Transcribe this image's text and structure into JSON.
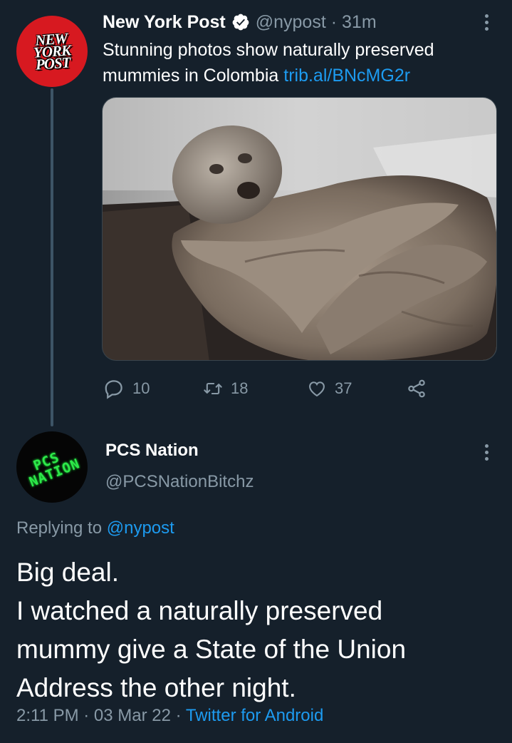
{
  "original_tweet": {
    "author": {
      "name": "New York Post",
      "handle": "@nypost",
      "time": "· 31m",
      "avatar_logo_lines": [
        "NEW",
        "YORK",
        "POST"
      ]
    },
    "text": "Stunning photos show naturally preserved mummies in Colombia ",
    "link": "trib.al/BNcMG2r",
    "media": {
      "icon": "photo-mummy"
    },
    "actions": {
      "replies": "10",
      "retweets": "18",
      "likes": "37"
    }
  },
  "reply_tweet": {
    "author": {
      "name": "PCS Nation",
      "handle": "@PCSNationBitchz",
      "avatar_logo_lines": [
        "PCS",
        "NATION"
      ]
    },
    "replying_to_label": "Replying to ",
    "replying_to_handle": "@nypost",
    "text_lines": [
      "Big deal.",
      "I watched a naturally preserved",
      "mummy give a State of the Union",
      "Address the other night."
    ],
    "timestamp": "2:11 PM · 03 Mar 22 · ",
    "source": "Twitter for Android"
  },
  "colors": {
    "background": "#15202b",
    "text": "#ffffff",
    "secondary": "#8899a6",
    "link": "#1d9bf0",
    "verified": "#ffffff"
  }
}
